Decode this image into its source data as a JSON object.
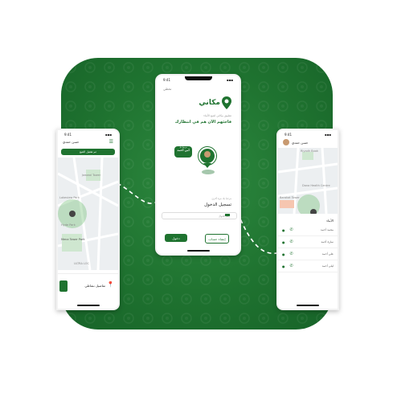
{
  "center_phone": {
    "time": "9:41",
    "back_label": "تخطي",
    "brand": "مكاني",
    "tagline_small": "تطبيق مكاني لتتبع الأبناء",
    "headline": "فاجئهم الآن هم في انتظارك",
    "bubble_small": "مرحبا بك",
    "bubble_main": "أبي أحمد",
    "login_small": "مرحبا بك مرة أخرى",
    "login_title": "تسجيل الدخول",
    "phone_placeholder": "رقم الجوال",
    "btn_primary": "دخول",
    "btn_secondary": "إنشاء حساب"
  },
  "left_phone": {
    "time": "9:41",
    "user_name": "حسن حمدي",
    "banner": "تم تفعيل التتبع",
    "map_labels": [
      "Lakeview Park",
      "Jawwal Tower",
      "Hyde Park",
      "Mena Tower Park",
      "ULTRA LOC",
      "Camping Gr"
    ],
    "footer_text": "تفاصيل نشاطي",
    "footer_btn": ""
  },
  "right_phone": {
    "time": "9:41",
    "user_name": "حسن حمدي",
    "map_labels": [
      "Riyadh Book",
      "Dana Health Centre",
      "Barakat Tower"
    ],
    "list_title": "الأبناء",
    "list": [
      {
        "name": "محمد أحمد"
      },
      {
        "name": "سارة أحمد"
      },
      {
        "name": "علي أحمد"
      },
      {
        "name": "ليلى أحمد"
      }
    ]
  },
  "colors": {
    "brand_green": "#1f7330",
    "tile_dark": "#176328"
  },
  "icons": [
    "pin-icon",
    "phone-icon",
    "menu-icon",
    "avatar-icon",
    "flag-icon"
  ]
}
